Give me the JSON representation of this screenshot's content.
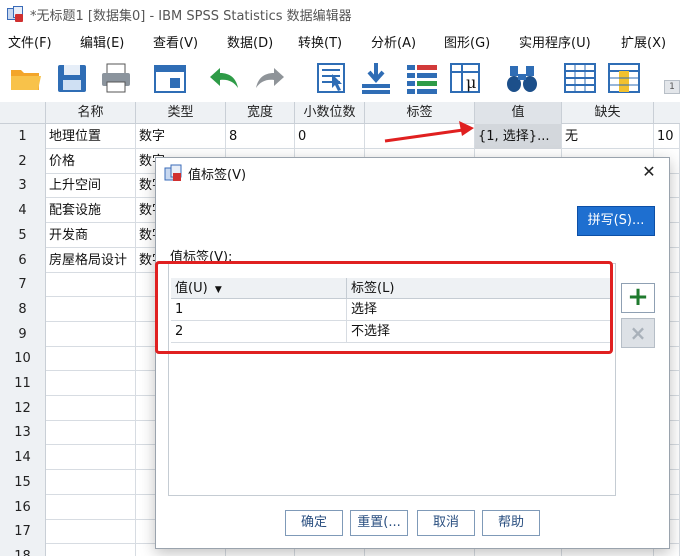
{
  "window": {
    "title": "*无标题1 [数据集0] - IBM SPSS Statistics 数据编辑器"
  },
  "menubar": [
    {
      "label": "文件(F)"
    },
    {
      "label": "编辑(E)"
    },
    {
      "label": "查看(V)"
    },
    {
      "label": "数据(D)"
    },
    {
      "label": "转换(T)"
    },
    {
      "label": "分析(A)"
    },
    {
      "label": "图形(G)"
    },
    {
      "label": "实用程序(U)"
    },
    {
      "label": "扩展(X)"
    }
  ],
  "toolbar": {
    "icons": [
      "open-folder-icon",
      "save-icon",
      "print-icon",
      "dialog-recall-icon",
      "undo-icon",
      "redo-icon",
      "goto-case-icon",
      "goto-variable-icon",
      "variables-icon",
      "run-descriptives-icon",
      "find-icon",
      "insert-cases-icon",
      "insert-variable-icon"
    ],
    "badge": "1"
  },
  "grid": {
    "columns": [
      "名称",
      "类型",
      "宽度",
      "小数位数",
      "标签",
      "值",
      "缺失"
    ],
    "rows": [
      {
        "num": "1",
        "cells": [
          "地理位置",
          "数字",
          "8",
          "0",
          "",
          "{1, 选择}...",
          "无",
          "10"
        ]
      },
      {
        "num": "2",
        "cells": [
          "价格",
          "数字",
          "",
          "",
          "",
          "",
          "",
          ""
        ]
      },
      {
        "num": "3",
        "cells": [
          "上升空间",
          "数字",
          "",
          "",
          "",
          "",
          "",
          ""
        ]
      },
      {
        "num": "4",
        "cells": [
          "配套设施",
          "数字",
          "",
          "",
          "",
          "",
          "",
          ""
        ]
      },
      {
        "num": "5",
        "cells": [
          "开发商",
          "数字",
          "",
          "",
          "",
          "",
          "",
          ""
        ]
      },
      {
        "num": "6",
        "cells": [
          "房屋格局设计",
          "数字",
          "",
          "",
          "",
          "",
          "",
          ""
        ]
      },
      {
        "num": "7",
        "cells": [
          "",
          "",
          "",
          "",
          "",
          "",
          "",
          ""
        ]
      },
      {
        "num": "8",
        "cells": [
          "",
          "",
          "",
          "",
          "",
          "",
          "",
          ""
        ]
      },
      {
        "num": "9",
        "cells": [
          "",
          "",
          "",
          "",
          "",
          "",
          "",
          ""
        ]
      },
      {
        "num": "10",
        "cells": [
          "",
          "",
          "",
          "",
          "",
          "",
          "",
          ""
        ]
      },
      {
        "num": "11",
        "cells": [
          "",
          "",
          "",
          "",
          "",
          "",
          "",
          ""
        ]
      },
      {
        "num": "12",
        "cells": [
          "",
          "",
          "",
          "",
          "",
          "",
          "",
          ""
        ]
      },
      {
        "num": "13",
        "cells": [
          "",
          "",
          "",
          "",
          "",
          "",
          "",
          ""
        ]
      },
      {
        "num": "14",
        "cells": [
          "",
          "",
          "",
          "",
          "",
          "",
          "",
          ""
        ]
      },
      {
        "num": "15",
        "cells": [
          "",
          "",
          "",
          "",
          "",
          "",
          "",
          ""
        ]
      },
      {
        "num": "16",
        "cells": [
          "",
          "",
          "",
          "",
          "",
          "",
          "",
          ""
        ]
      },
      {
        "num": "17",
        "cells": [
          "",
          "",
          "",
          "",
          "",
          "",
          "",
          ""
        ]
      },
      {
        "num": "18",
        "cells": [
          "",
          "",
          "",
          "",
          "",
          "",
          "",
          ""
        ]
      }
    ]
  },
  "dialog": {
    "title": "值标签(V)",
    "spell_button": "拼写(S)...",
    "value_labels_caption": "值标签(V):",
    "table": {
      "headers": [
        "值(U)",
        "标签(L)"
      ],
      "rows": [
        {
          "value": "1",
          "label": "选择"
        },
        {
          "value": "2",
          "label": "不选择"
        }
      ]
    },
    "add_button": "+",
    "delete_button": "×",
    "buttons": {
      "ok": "确定",
      "reset": "重置(...",
      "cancel": "取消",
      "help": "帮助"
    }
  },
  "colors": {
    "accent": "#1e6fd0",
    "annotation": "#e02020",
    "add_green": "#1f7a2e"
  }
}
